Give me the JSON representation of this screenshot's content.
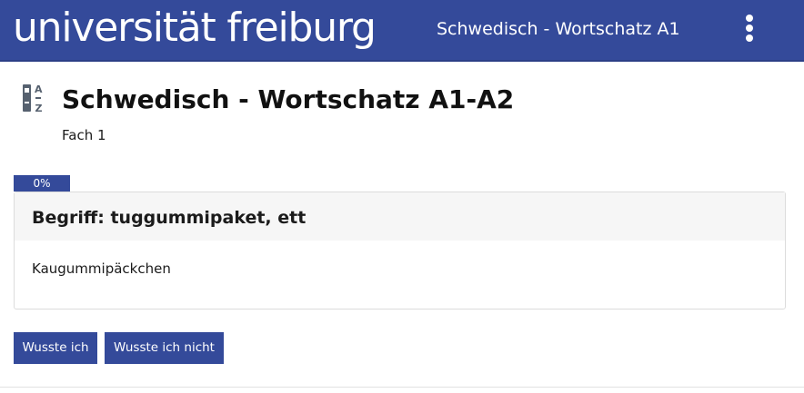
{
  "header": {
    "brand": "universität freiburg",
    "course_title": "Schwedisch - Wortschatz A1-A2",
    "menu_icon": "vertical-ellipsis-icon",
    "background_color": "#344a9a"
  },
  "page": {
    "icon": "glossary-az-icon",
    "title": "Schwedisch - Wortschatz A1-A2",
    "subtitle": "Fach 1"
  },
  "progress": {
    "label": "0%",
    "value": 0
  },
  "card": {
    "term": "Begriff: tuggummipaket, ett",
    "definition": "Kaugummipäckchen"
  },
  "actions": {
    "known_label": "Wusste ich",
    "unknown_label": "Wusste ich nicht"
  }
}
